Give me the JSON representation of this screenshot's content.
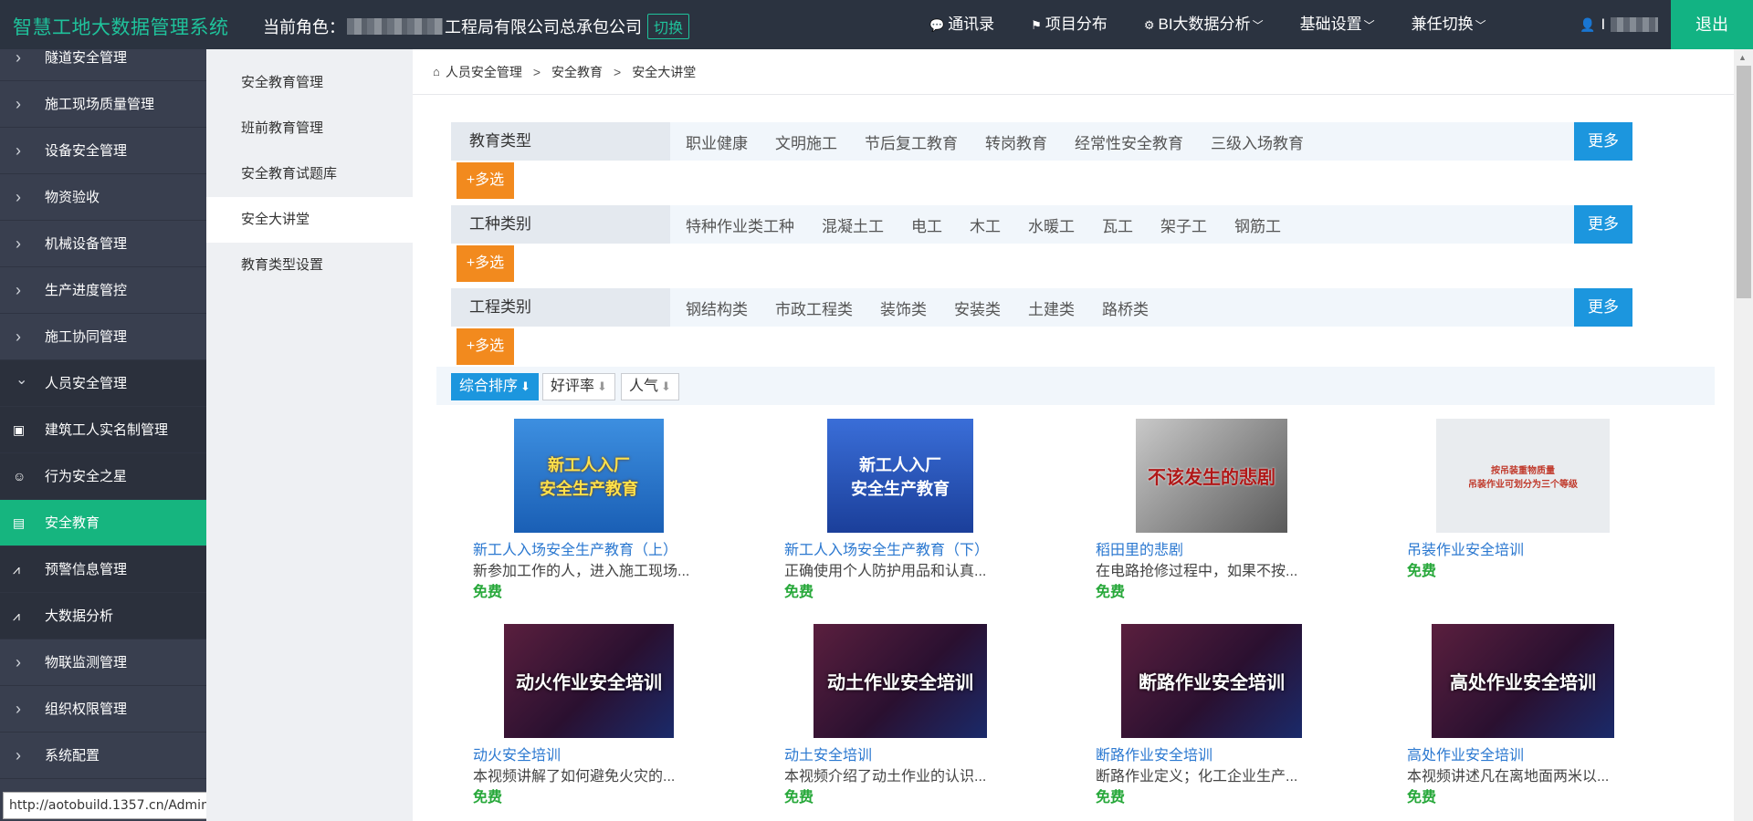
{
  "app": {
    "title": "智慧工地大数据管理系统",
    "role_label": "当前角色：",
    "role_value": "工程局有限公司总承包公司",
    "switch_label": "切换",
    "logout_label": "退出",
    "accent_color": "#1fc29b"
  },
  "topnav": [
    {
      "icon": "contacts-icon",
      "glyph": "💬",
      "label": "通讯录"
    },
    {
      "icon": "project-map-icon",
      "glyph": "⚑",
      "label": "项目分布"
    },
    {
      "icon": "bi-analysis-icon",
      "glyph": "⚙",
      "label": "BI大数据分析"
    },
    {
      "icon": "settings-icon",
      "glyph": "",
      "label": "基础设置"
    },
    {
      "icon": "role-switch-icon",
      "glyph": "",
      "label": "兼任切换"
    }
  ],
  "user": {
    "glyph": "👤",
    "name": "I"
  },
  "sidebar": [
    {
      "label": "隧道安全管理",
      "type": "chevron"
    },
    {
      "label": "施工现场质量管理",
      "type": "chevron"
    },
    {
      "label": "设备安全管理",
      "type": "chevron"
    },
    {
      "label": "物资验收",
      "type": "chevron"
    },
    {
      "label": "机械设备管理",
      "type": "chevron"
    },
    {
      "label": "生产进度管控",
      "type": "chevron"
    },
    {
      "label": "施工协同管理",
      "type": "chevron"
    },
    {
      "label": "人员安全管理",
      "type": "expanded"
    },
    {
      "label": "建筑工人实名制管理",
      "type": "child",
      "icon": "id-card-icon",
      "glyph": "▣"
    },
    {
      "label": "行为安全之星",
      "type": "child",
      "icon": "user-star-icon",
      "glyph": "☺"
    },
    {
      "label": "安全教育",
      "type": "child-active",
      "icon": "document-icon",
      "glyph": "▤"
    },
    {
      "label": "预警信息管理",
      "type": "child",
      "icon": "trend-icon",
      "glyph": "⩘"
    },
    {
      "label": "大数据分析",
      "type": "child",
      "icon": "trend-icon",
      "glyph": "⩘"
    },
    {
      "label": "物联监测管理",
      "type": "chevron"
    },
    {
      "label": "组织权限管理",
      "type": "chevron"
    },
    {
      "label": "系统配置",
      "type": "chevron"
    }
  ],
  "status_url": "http://aotobuild.1357.cn/Admin/EduVideo/show?id=11",
  "submenu": [
    "安全教育管理",
    "班前教育管理",
    "安全教育试题库",
    "安全大讲堂",
    "教育类型设置"
  ],
  "submenu_active": "安全大讲堂",
  "breadcrumb": [
    "人员安全管理",
    "安全教育",
    "安全大讲堂"
  ],
  "filters": [
    {
      "label": "教育类型",
      "options": [
        "职业健康",
        "文明施工",
        "节后复工教育",
        "转岗教育",
        "经常性安全教育",
        "三级入场教育"
      ]
    },
    {
      "label": "工种类别",
      "options": [
        "特种作业类工种",
        "混凝土工",
        "电工",
        "木工",
        "水暖工",
        "瓦工",
        "架子工",
        "钢筋工"
      ]
    },
    {
      "label": "工程类别",
      "options": [
        "钢结构类",
        "市政工程类",
        "装饰类",
        "安装类",
        "土建类",
        "路桥类"
      ]
    }
  ],
  "more_label": "更多",
  "multi_label": "+多选",
  "sort": [
    {
      "label": "综合排序",
      "arrow": "⬇",
      "active": true
    },
    {
      "label": "好评率",
      "arrow": "⬇",
      "active": false
    },
    {
      "label": "人气",
      "arrow": "⬇",
      "active": false
    }
  ],
  "videos": [
    {
      "title": "新工人入场安全生产教育（上）",
      "desc": "新参加工作的人，进入施工现场...",
      "price": "免费",
      "thumb_text": "新工人入厂\n安全生产教育",
      "thumb_bg": "#2f7bd0",
      "thumb_fg": "#ffe14a"
    },
    {
      "title": "新工人入场安全生产教育（下）",
      "desc": "正确使用个人防护用品和认真...",
      "price": "免费",
      "thumb_text": "新工人入厂\n安全生产教育",
      "thumb_bg": "#1f4fb8",
      "thumb_fg": "#ffffff"
    },
    {
      "title": "稻田里的悲剧",
      "desc": "在电路抢修过程中，如果不按...",
      "price": "免费",
      "thumb_text": "不该发生的悲剧",
      "thumb_bg": "#8f8f8f",
      "thumb_fg": "#b01818"
    },
    {
      "title": "吊装作业安全培训",
      "desc": "",
      "price": "免费",
      "thumb_text": "按吊装重物质量\n吊装作业可划分为三个等级",
      "thumb_bg": "#e9ecef",
      "thumb_fg": "#c0392b"
    },
    {
      "title": "动火安全培训",
      "desc": "本视频讲解了如何避免火灾的...",
      "price": "免费",
      "thumb_text": "动火作业安全培训",
      "thumb_bg": "#3a1d3a",
      "thumb_fg": "#ffffff"
    },
    {
      "title": "动土安全培训",
      "desc": "本视频介绍了动土作业的认识...",
      "price": "免费",
      "thumb_text": "动土作业安全培训",
      "thumb_bg": "#3a1d3a",
      "thumb_fg": "#ffffff"
    },
    {
      "title": "断路作业安全培训",
      "desc": "断路作业定义；化工企业生产...",
      "price": "免费",
      "thumb_text": "断路作业安全培训",
      "thumb_bg": "#3a1d3a",
      "thumb_fg": "#ffffff"
    },
    {
      "title": "高处作业安全培训",
      "desc": "本视频讲述凡在离地面两米以...",
      "price": "免费",
      "thumb_text": "高处作业安全培训",
      "thumb_bg": "#3a1d3a",
      "thumb_fg": "#ffffff"
    }
  ]
}
